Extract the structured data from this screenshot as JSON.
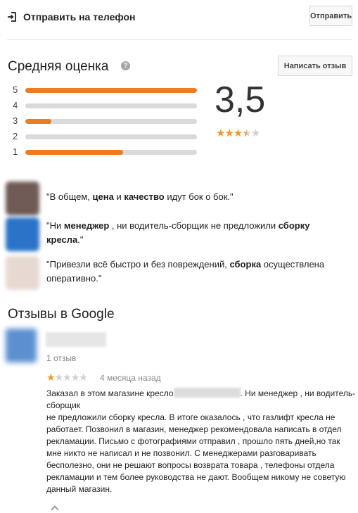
{
  "send_to_phone": {
    "title": "Отправить на телефон",
    "button_label": "Отправить",
    "icon": "send-to-phone-icon"
  },
  "rating": {
    "title": "Средняя оценка",
    "help_icon": "?",
    "write_review_label": "Написать отзыв",
    "score": "3,5",
    "stars_value": 3.5,
    "stars_max": 5,
    "histogram": [
      {
        "label": "5",
        "fraction": 1.0
      },
      {
        "label": "4",
        "fraction": 0.0
      },
      {
        "label": "3",
        "fraction": 0.15
      },
      {
        "label": "2",
        "fraction": 0.0
      },
      {
        "label": "1",
        "fraction": 0.57
      }
    ],
    "accent_color": "#ee7a22"
  },
  "snippets": [
    {
      "thumb_color": "#6f5a55",
      "parts": [
        {
          "text": "\"В общем, ",
          "bold": false
        },
        {
          "text": "цена",
          "bold": true
        },
        {
          "text": " и ",
          "bold": false
        },
        {
          "text": "качество",
          "bold": true
        },
        {
          "text": " идут бок о бок.\"",
          "bold": false
        }
      ]
    },
    {
      "thumb_color": "#2b73c8",
      "parts": [
        {
          "text": "\"Ни ",
          "bold": false
        },
        {
          "text": "менеджер",
          "bold": true
        },
        {
          "text": " , ни водитель-сборщик не предложили ",
          "bold": false
        },
        {
          "text": "сборку кресла",
          "bold": true
        },
        {
          "text": ".\"",
          "bold": false
        }
      ]
    },
    {
      "thumb_color": "#e7d9d2",
      "parts": [
        {
          "text": "\"Привезли всё быстро и без повреждений, ",
          "bold": false
        },
        {
          "text": "сборка",
          "bold": true
        },
        {
          "text": " осуществлена оперативно.\"",
          "bold": false
        }
      ]
    }
  ],
  "google_reviews": {
    "title": "Отзывы в Google",
    "review": {
      "count_text": "1 отзыв",
      "stars_value": 1,
      "stars_max": 5,
      "date": "4 месяца назад",
      "body_before": "Заказал в этом магазине кресло",
      "body_after": ". Ни менеджер , ни водитель-сборщик",
      "body_rest": "не предложили сборку кресла. В итоге оказалось , что газлифт кресла не работает. Позвонил в магазин, менеджер рекомендовала написать в отдел рекламации. Письмо с фотографиями отправил , прошло пять дней,но так мне никто не написал и не позвонил. С менеджерами разговаривать бесполезно, они не решают вопросы возврата товара , телефоны отдела  рекламации и тем более руководства не дают. Вообщем никому не советую данный магазин."
    }
  }
}
